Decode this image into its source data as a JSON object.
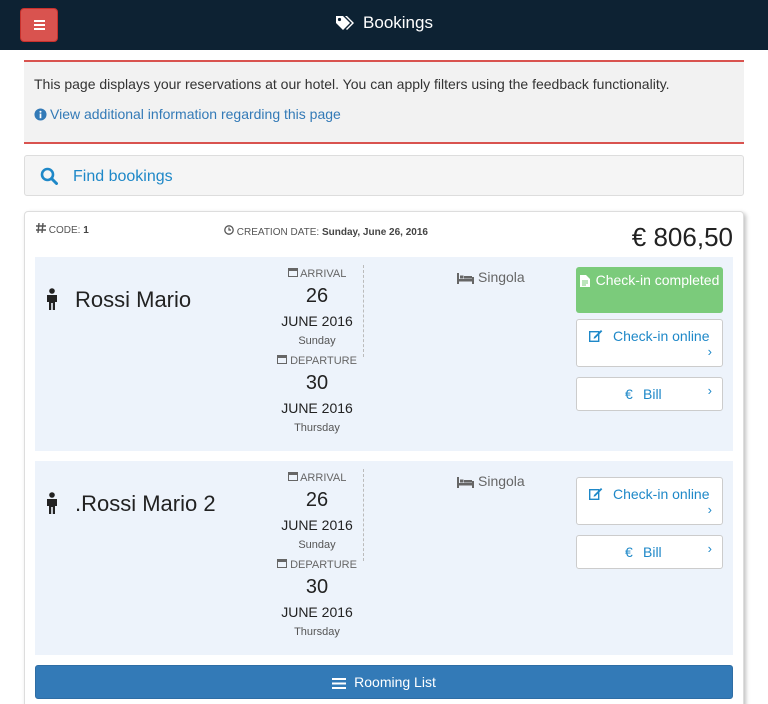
{
  "header": {
    "title": "Bookings",
    "menu_icon": "hamburger-icon",
    "title_icon": "tags-icon"
  },
  "info": {
    "text": "This page displays your reservations at our hotel. You can apply filters using the feedback functionality.",
    "link_label": "View additional information regarding this page"
  },
  "search": {
    "label": "Find bookings"
  },
  "booking": {
    "code_label": "CODE:",
    "code_value": "1",
    "creation_label": "CREATION DATE:",
    "creation_value": "Sunday, June 26, 2016",
    "price": "€ 806,50",
    "guests": [
      {
        "name": "Rossi Mario",
        "arrival_label": "ARRIVAL",
        "arrival_day": "26",
        "arrival_month": "JUNE 2016",
        "arrival_weekday": "Sunday",
        "departure_label": "DEPARTURE",
        "departure_day": "30",
        "departure_month": "JUNE 2016",
        "departure_weekday": "Thursday",
        "room": "Singola",
        "checkin_done_label": "Check-in completed",
        "checkin_online_label": "Check-in online",
        "bill_label": "Bill",
        "bill_symbol": "€"
      },
      {
        "name": ".Rossi Mario 2",
        "arrival_label": "ARRIVAL",
        "arrival_day": "26",
        "arrival_month": "JUNE 2016",
        "arrival_weekday": "Sunday",
        "departure_label": "DEPARTURE",
        "departure_day": "30",
        "departure_month": "JUNE 2016",
        "departure_weekday": "Thursday",
        "room": "Singola",
        "checkin_online_label": "Check-in online",
        "bill_label": "Bill",
        "bill_symbol": "€"
      }
    ],
    "rooming_list_label": "Rooming List"
  },
  "colors": {
    "topbar": "#0d2233",
    "menu_button": "#d9534f",
    "link": "#1e88c8",
    "checkin_done": "#7bcb7b",
    "rooming_button": "#337ab7",
    "guest_row_bg": "#edf3fb"
  }
}
